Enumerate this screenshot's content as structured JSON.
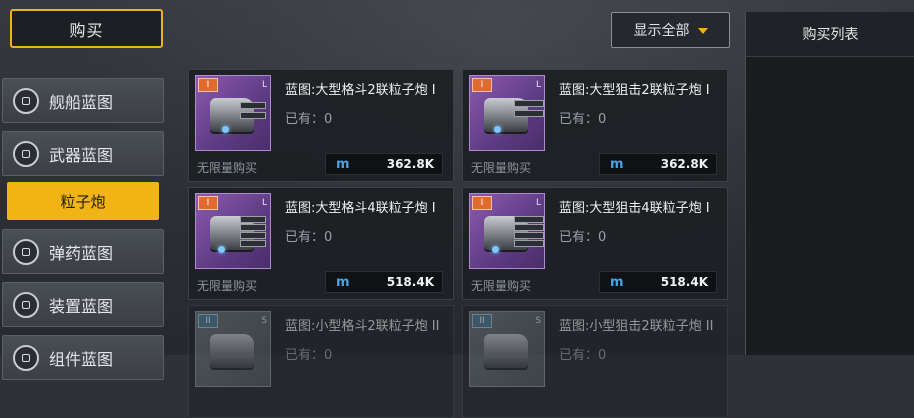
{
  "top": {
    "buy_tab": "购买",
    "filter": "显示全部",
    "list_title": "购买列表"
  },
  "sidebar": {
    "items": [
      {
        "label": "舰船蓝图"
      },
      {
        "label": "武器蓝图"
      },
      {
        "label": "弹药蓝图"
      },
      {
        "label": "装置蓝图"
      },
      {
        "label": "组件蓝图"
      }
    ],
    "selected_sub": "粒子炮"
  },
  "cards": [
    {
      "name": "蓝图:大型格斗2联粒子炮 I",
      "owned": "已有：0",
      "limit": "无限量购买",
      "price": "362.8K",
      "tier": "I",
      "class": "L"
    },
    {
      "name": "蓝图:大型狙击2联粒子炮 I",
      "owned": "已有：0",
      "limit": "无限量购买",
      "price": "362.8K",
      "tier": "I",
      "class": "L"
    },
    {
      "name": "蓝图:大型格斗4联粒子炮 I",
      "owned": "已有：0",
      "limit": "无限量购买",
      "price": "518.4K",
      "tier": "I",
      "class": "L"
    },
    {
      "name": "蓝图:大型狙击4联粒子炮 I",
      "owned": "已有：0",
      "limit": "无限量购买",
      "price": "518.4K",
      "tier": "I",
      "class": "L"
    },
    {
      "name": "蓝图:小型格斗2联粒子炮 II",
      "owned": "已有：0",
      "limit": "",
      "price": "",
      "tier": "II",
      "class": "S"
    },
    {
      "name": "蓝图:小型狙击2联粒子炮 II",
      "owned": "已有：0",
      "limit": "",
      "price": "",
      "tier": "II",
      "class": "S"
    }
  ],
  "currency_icon": "m-currency-icon",
  "colors": {
    "accent": "#f2b414",
    "rare_purple": "#7a4aa0",
    "currency_blue": "#4aa3e6"
  }
}
